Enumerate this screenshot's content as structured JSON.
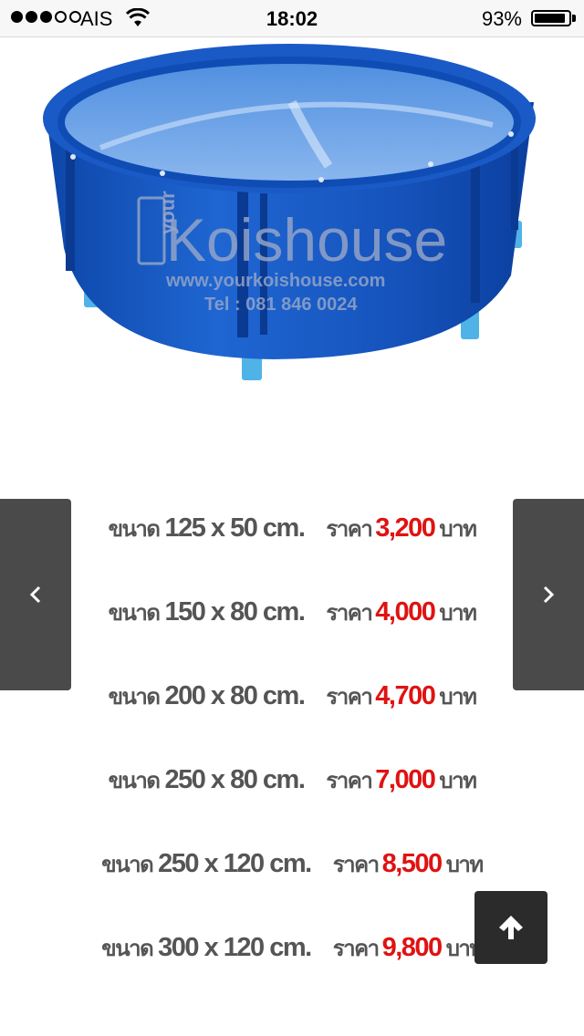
{
  "status_bar": {
    "carrier": "AIS",
    "time": "18:02",
    "battery_percent": "93%",
    "battery_level": 0.93,
    "signal_bars_filled": 3,
    "signal_bars_total": 5
  },
  "product_image": {
    "watermark_brand_small": "your",
    "watermark_brand": "Koishouse",
    "watermark_url": "www.yourkoishouse.com",
    "watermark_phone": "Tel : 081  846 0024"
  },
  "slider": {
    "prev_icon": "chevron-left-icon",
    "next_icon": "chevron-right-icon"
  },
  "price_list": [
    {
      "size_label": "ขนาด",
      "size": "125 x 50 cm.",
      "price_label": "ราคา",
      "price": "3,200",
      "unit": "บาท"
    },
    {
      "size_label": "ขนาด",
      "size": "150 x 80 cm.",
      "price_label": "ราคา",
      "price": "4,000",
      "unit": "บาท"
    },
    {
      "size_label": "ขนาด",
      "size": "200 x 80 cm.",
      "price_label": "ราคา",
      "price": "4,700",
      "unit": "บาท"
    },
    {
      "size_label": "ขนาด",
      "size": "250 x 80 cm.",
      "price_label": "ราคา",
      "price": "7,000",
      "unit": "บาท"
    },
    {
      "size_label": "ขนาด",
      "size": "250 x 120 cm.",
      "price_label": "ราคา",
      "price": "8,500",
      "unit": "บาท"
    },
    {
      "size_label": "ขนาด",
      "size": "300 x 120 cm.",
      "price_label": "ราคา",
      "price": "9,800",
      "unit": "บาท"
    }
  ],
  "back_to_top": {
    "icon": "arrow-up-icon"
  },
  "colors": {
    "price": "#e01212",
    "text": "#555555",
    "slider_button": "#4a4a4a",
    "back_to_top": "#2b2b2b",
    "pond_blue": "#1f5fc4"
  }
}
